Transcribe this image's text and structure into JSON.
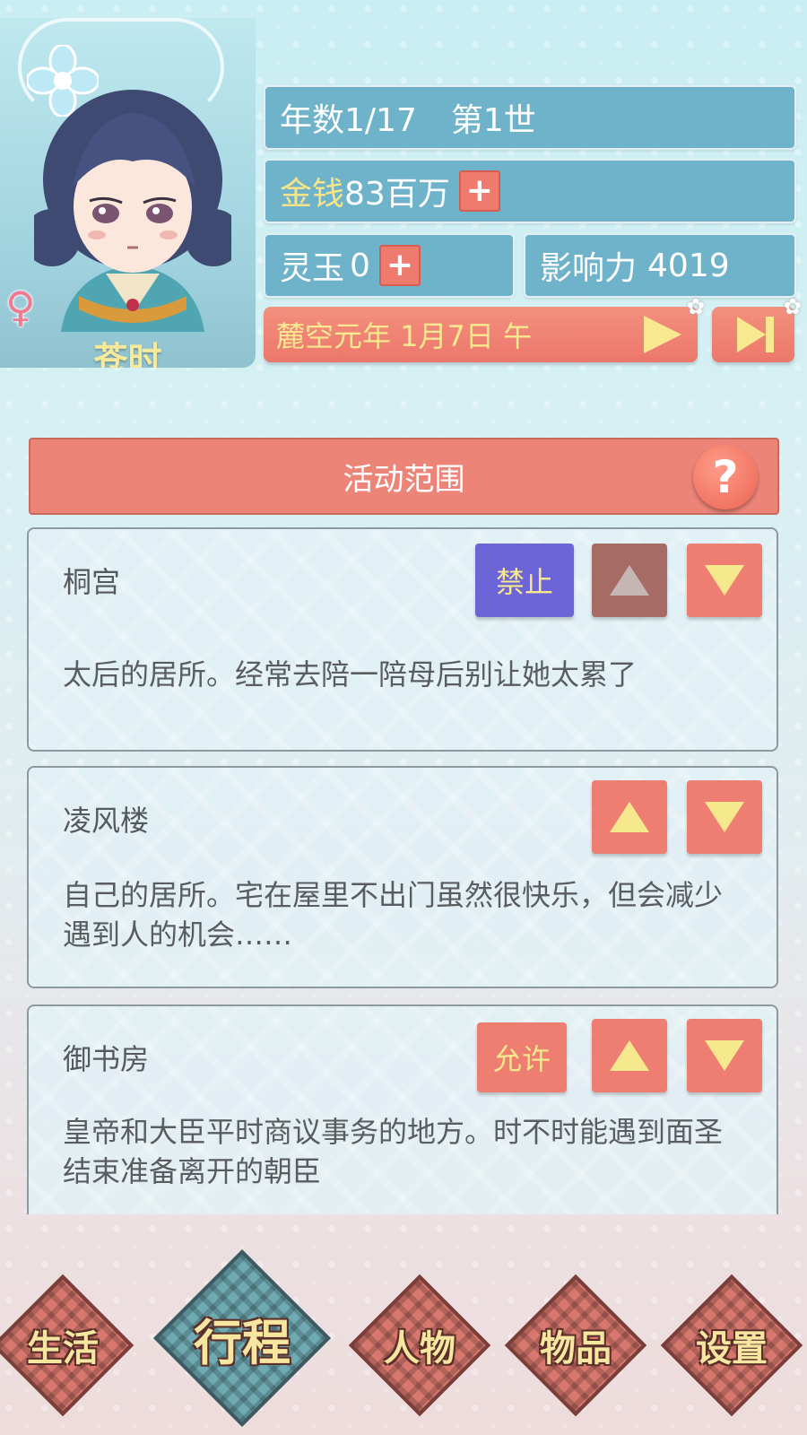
{
  "character": {
    "name": "苍时",
    "gender_symbol": "♀"
  },
  "stats": {
    "year_label": "年数1/17",
    "life_label": "第1世",
    "money_label": "金钱",
    "money_value": "83百万",
    "jade_label": "灵玉",
    "jade_value": "0",
    "influence_label": "影响力",
    "influence_value": "4019",
    "plus": "+",
    "date": "麓空元年 1月7日 午"
  },
  "activity": {
    "header": "活动范围",
    "help": "?",
    "places": [
      {
        "name": "桐宫",
        "toggle_label": "禁止",
        "description": "太后的居所。经常去陪一陪母后别让她太累了"
      },
      {
        "name": "凌风楼",
        "toggle_label": "",
        "description": "自己的居所。宅在屋里不出门虽然很快乐，但会减少遇到人的机会……"
      },
      {
        "name": "御书房",
        "toggle_label": "允许",
        "description": "皇帝和大臣平时商议事务的地方。时不时能遇到面圣结束准备离开的朝臣"
      }
    ]
  },
  "nav": {
    "items": [
      "生活",
      "行程",
      "人物",
      "物品",
      "设置"
    ],
    "active": "行程"
  },
  "colors": {
    "stat_bar": "#6fb3cb",
    "accent_red": "#ef7e72",
    "forbid_purple": "#6d64d8",
    "gold_text": "#f6e88d"
  }
}
